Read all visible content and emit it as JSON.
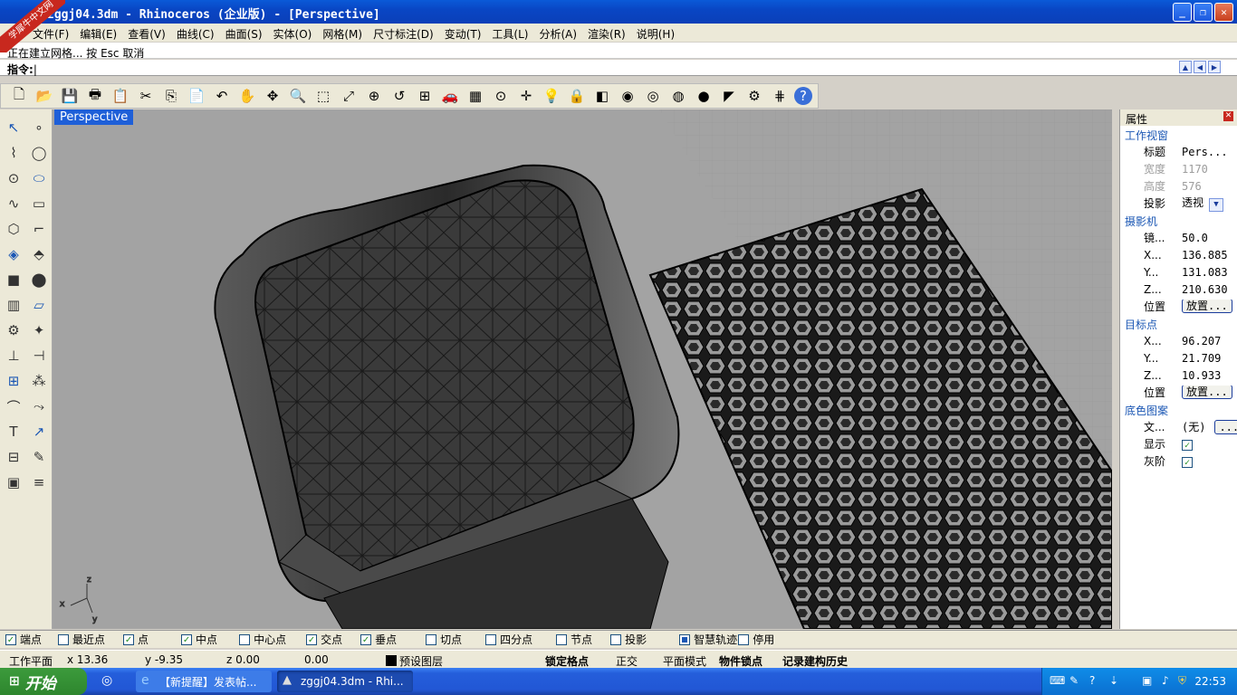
{
  "window": {
    "title": "zggj04.3dm - Rhinoceros (企业版) - [Perspective]",
    "watermark": "学犀牛中文网"
  },
  "menubar": [
    "文件(F)",
    "编辑(E)",
    "查看(V)",
    "曲线(C)",
    "曲面(S)",
    "实体(O)",
    "网格(M)",
    "尺寸标注(D)",
    "变动(T)",
    "工具(L)",
    "分析(A)",
    "渲染(R)",
    "说明(H)"
  ],
  "command": {
    "history": "正在建立网格... 按 Esc 取消",
    "prompt": "指令:"
  },
  "toolbar_icons": [
    "new-icon",
    "open-icon",
    "save-icon",
    "print-icon",
    "paste-icon",
    "cut-icon",
    "copy-icon",
    "clipboard-icon",
    "undo-icon",
    "pan-hand-icon",
    "rotate-view-icon",
    "zoom-icon",
    "zoom-window-icon",
    "zoom-extents-icon",
    "zoom-selected-icon",
    "undo-view-icon",
    "viewports-icon",
    "car-icon",
    "grid-icon",
    "snap-icon",
    "point-icon",
    "light-icon",
    "lock-icon",
    "layer-icon",
    "color-icon",
    "wireframe-icon",
    "shaded-icon",
    "render-icon",
    "select-icon",
    "settings-icon",
    "options-icon",
    "help-icon"
  ],
  "viewport": {
    "name": "Perspective",
    "axes": {
      "x": "x",
      "y": "y",
      "z": "z"
    }
  },
  "properties": {
    "panel_title": "属性",
    "sections": {
      "viewport": "工作视窗",
      "camera": "摄影机",
      "target": "目标点",
      "wallpaper": "底色图案"
    },
    "viewport_rows": [
      {
        "label": "标题",
        "value": "Pers..."
      },
      {
        "label": "宽度",
        "value": "1170"
      },
      {
        "label": "高度",
        "value": "576"
      },
      {
        "label": "投影",
        "value": "透视"
      }
    ],
    "camera_rows": [
      {
        "label": "镜...",
        "value": "50.0"
      },
      {
        "label": "X...",
        "value": "136.885"
      },
      {
        "label": "Y...",
        "value": "131.083"
      },
      {
        "label": "Z...",
        "value": "210.630"
      },
      {
        "label": "位置",
        "value": "放置..."
      }
    ],
    "target_rows": [
      {
        "label": "X...",
        "value": "96.207"
      },
      {
        "label": "Y...",
        "value": "21.709"
      },
      {
        "label": "Z...",
        "value": "10.933"
      },
      {
        "label": "位置",
        "value": "放置..."
      }
    ],
    "wallpaper_rows": [
      {
        "label": "文...",
        "value": "(无)",
        "button": "..."
      },
      {
        "label": "显示",
        "checked": true
      },
      {
        "label": "灰阶",
        "checked": true
      }
    ]
  },
  "osnap": [
    {
      "label": "端点",
      "checked": true
    },
    {
      "label": "最近点",
      "checked": false
    },
    {
      "label": "点",
      "checked": true
    },
    {
      "label": "中点",
      "checked": true
    },
    {
      "label": "中心点",
      "checked": false
    },
    {
      "label": "交点",
      "checked": true
    },
    {
      "label": "垂点",
      "checked": true
    },
    {
      "label": "切点",
      "checked": false
    },
    {
      "label": "四分点",
      "checked": false
    },
    {
      "label": "节点",
      "checked": false
    },
    {
      "label": "投影",
      "checked": false
    },
    {
      "label": "智慧轨迹",
      "checked": true
    },
    {
      "label": "停用",
      "checked": false
    }
  ],
  "statusbar": {
    "cplane": "工作平面",
    "x": "x 13.36",
    "y": "y -9.35",
    "z": "z 0.00",
    "dist": "0.00",
    "layer": "预设图层",
    "snap_grid": "锁定格点",
    "ortho": "正交",
    "planar": "平面模式",
    "osnap": "物件锁点",
    "history": "记录建构历史"
  },
  "taskbar": {
    "start": "开始",
    "tasks": [
      "【新提醒】发表帖...",
      "zggj04.3dm - Rhi..."
    ],
    "clock": "22:53"
  },
  "colors": {
    "accent": "#1e5fd8",
    "title_bar": "#0a5ad8",
    "viewport_bg": "#a3a3a3"
  }
}
